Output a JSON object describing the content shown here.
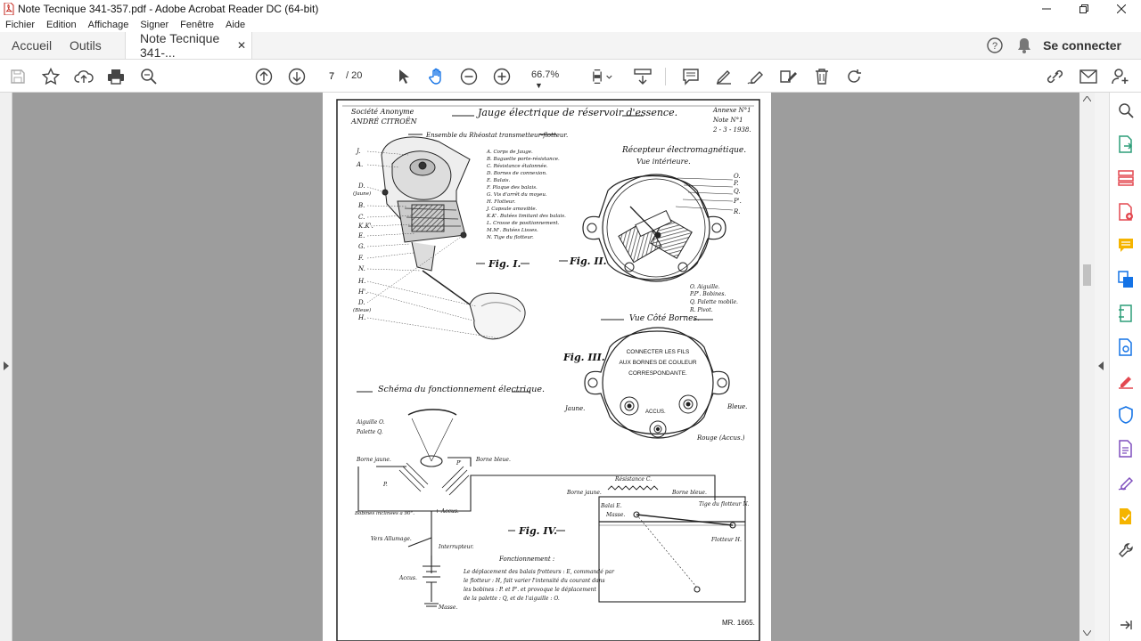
{
  "window": {
    "title": "Note Tecnique 341-357.pdf - Adobe Acrobat Reader DC (64-bit)"
  },
  "menu": [
    "Fichier",
    "Edition",
    "Affichage",
    "Signer",
    "Fenêtre",
    "Aide"
  ],
  "tabs": {
    "home": "Accueil",
    "tools": "Outils",
    "document": "Note Tecnique 341-...",
    "connect": "Se connecter"
  },
  "toolbar": {
    "page_current": "7",
    "page_total": "/ 20",
    "zoom": "66.7%"
  },
  "document": {
    "company_line1": "Société Anonyme",
    "company_line2": "ANDRÉ CITROËN",
    "main_title": "Jauge électrique de réservoir d'essence.",
    "annex_line1": "Annexe N°1",
    "annex_line2": "Note N°1",
    "annex_date": "2 - 3 - 1938.",
    "ensemble_title": "Ensemble du Rhéostat transmetteur-flotteur.",
    "fig1_labels": [
      "J.",
      "A.",
      "D.",
      "(Jaune)",
      "B.",
      "C.",
      "K.K'.",
      "E.",
      "G.",
      "F.",
      "N.",
      "H.",
      "H'.",
      "D.",
      "(Bleue)",
      "H."
    ],
    "fig1_legend": [
      "A. Corps de Jauge.",
      "B. Baguette porte-résistance.",
      "C. Résistance étalonnée.",
      "D. Bornes de connexion.",
      "E. Balais.",
      "F. Plaque des balais.",
      "G. Vis d'arrêt du moyeu.",
      "H. Flotteur.",
      "J. Capsule amovible.",
      "K.K'. Butées limitant des balais.",
      "L. Crosse de positionnement.",
      "M.M'. Butées Lisses.",
      "N. Tige du flotteur."
    ],
    "fig1": "Fig. I.",
    "recepteur_title": "Récepteur électromagnétique.",
    "recepteur_sub": "Vue intérieure.",
    "fig2_labels": [
      "O.",
      "P.",
      "Q.",
      "P'.",
      "R."
    ],
    "fig2": "Fig. II.",
    "fig2_legend": [
      "O. Aiguille.",
      "P.P'. Bobines.",
      "Q. Palette mobile.",
      "R. Pivot."
    ],
    "vue_bornes": "Vue Côté Bornes.",
    "fig3": "Fig. III.",
    "connect_line1": "CONNECTER LES FILS",
    "connect_line2": "AUX BORNES DE COULEUR",
    "connect_line3": "CORRESPONDANTE.",
    "fig3_jaune": "Jaune.",
    "fig3_accus": "ACCUS.",
    "fig3_bleue": "Bleue.",
    "fig3_rouge": "Rouge (Accus.)",
    "schema_title": "Schéma du fonctionnement électrique.",
    "fig4_labels": {
      "aiguille": "Aiguille O.",
      "palette": "Palette Q.",
      "borne_jaune": "Borne jaune.",
      "p_prime": "P'",
      "borne_bleue": "Borne bleue.",
      "p": "P.",
      "bobines": "Bobines inclinées à 90°.",
      "accus_arrow": "+ Accus.",
      "resistance": "Résistance C.",
      "borne_jaune2": "Borne jaune.",
      "borne_bleue2": "Borne bleue.",
      "balai": "Balai E.",
      "masse": "Masse.",
      "tige": "Tige du flotteur N.",
      "flotteur": "Flotteur H.",
      "vers_allumage": "Vers Allumage.",
      "interrupteur": "Interrupteur.",
      "accus": "Accus.",
      "masse2": "Masse."
    },
    "fig4": "Fig. IV.",
    "fonctionnement_title": "Fonctionnement :",
    "fonctionnement_text": [
      "Le déplacement des balais frotteurs : E, commandé par",
      "le flotteur : H, fait varier l'intensité du courant dans",
      "les bobines : P. et P'. et provoque le déplacement",
      "de la palette : Q, et de l'aiguille : O."
    ],
    "ref": "MR. 1665."
  },
  "colors": {
    "workspace": "#9d9d9d",
    "accent_blue": "#1473e6",
    "sidebar_red": "#e34850",
    "sidebar_green": "#2d9d78",
    "sidebar_purple": "#7e4ebd",
    "sidebar_orange": "#e68619"
  }
}
